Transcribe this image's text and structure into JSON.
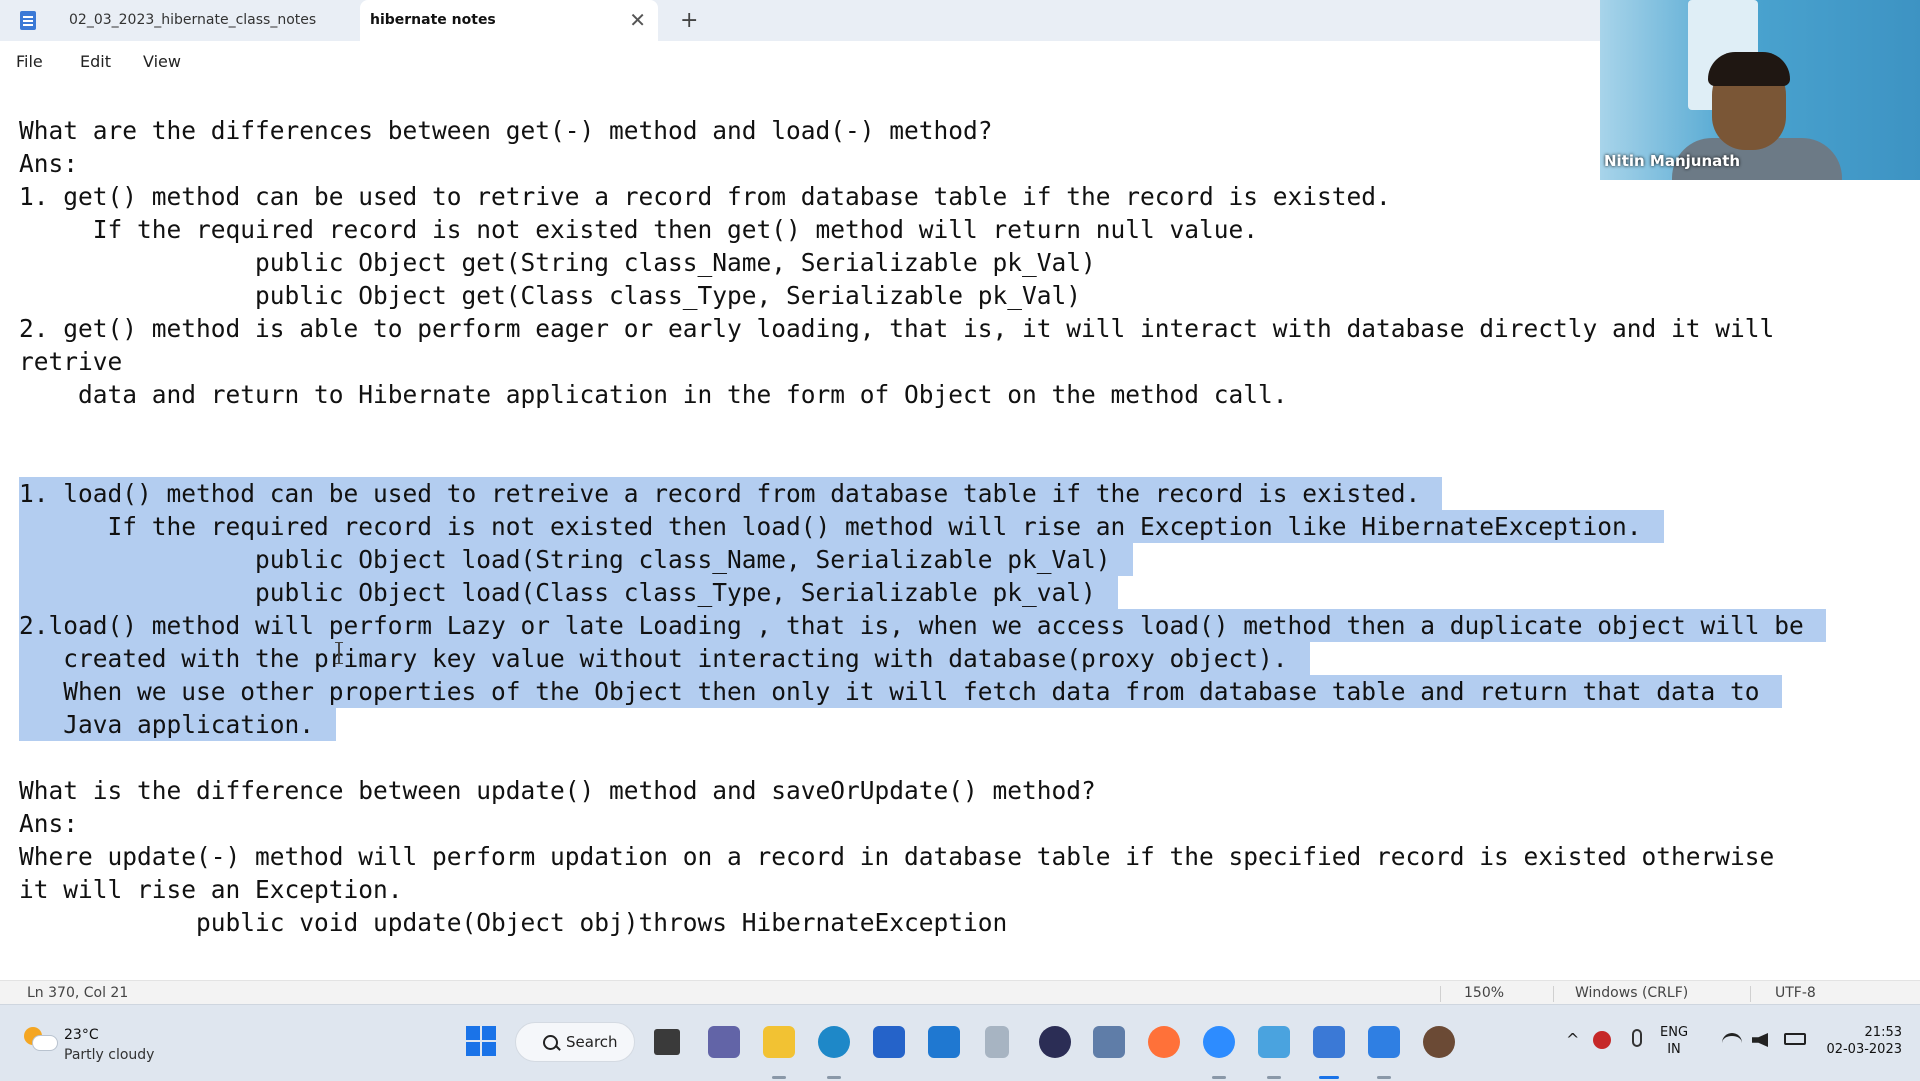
{
  "tabs": [
    {
      "label": "02_03_2023_hibernate_class_notes"
    },
    {
      "label": "hibernate notes",
      "active": true
    }
  ],
  "close_glyph": "✕",
  "add_glyph": "+",
  "menu": {
    "file": "File",
    "edit": "Edit",
    "view": "View"
  },
  "editor_lines": [
    {
      "text": "What are the differences between get(-) method and load(-) method?",
      "selected": false
    },
    {
      "text": "Ans:",
      "selected": false
    },
    {
      "text": "1. get() method can be used to retrive a record from database table if the record is existed.",
      "selected": false
    },
    {
      "text": "     If the required record is not existed then get() method will return null value.",
      "selected": false
    },
    {
      "text": "                public Object get(String class_Name, Serializable pk_Val)",
      "selected": false
    },
    {
      "text": "                public Object get(Class class_Type, Serializable pk_Val)",
      "selected": false
    },
    {
      "text": "2. get() method is able to perform eager or early loading, that is, it will interact with database directly and it will",
      "selected": false
    },
    {
      "text": "retrive",
      "selected": false
    },
    {
      "text": "    data and return to Hibernate application in the form of Object on the method call.",
      "selected": false
    },
    {
      "text": "",
      "selected": false
    },
    {
      "text": "",
      "selected": false
    },
    {
      "text": "1. load() method can be used to retreive a record from database table if the record is existed.",
      "selected": true
    },
    {
      "text": "      If the required record is not existed then load() method will rise an Exception like HibernateException.",
      "selected": true
    },
    {
      "text": "                public Object load(String class_Name, Serializable pk_Val)",
      "selected": true
    },
    {
      "text": "                public Object load(Class class_Type, Serializable pk_val)",
      "selected": true
    },
    {
      "text": "2.load() method will perform Lazy or late Loading , that is, when we access load() method then a duplicate object will be",
      "selected": true
    },
    {
      "text": "   created with the primary key value without interacting with database(proxy object).",
      "selected": true
    },
    {
      "text": "   When we use other properties of the Object then only it will fetch data from database table and return that data to",
      "selected": true
    },
    {
      "text": "   Java application.",
      "selected": true
    },
    {
      "text": "",
      "selected": false
    },
    {
      "text": "What is the difference between update() method and saveOrUpdate() method?",
      "selected": false
    },
    {
      "text": "Ans:",
      "selected": false
    },
    {
      "text": "Where update(-) method will perform updation on a record in database table if the specified record is existed otherwise",
      "selected": false
    },
    {
      "text": "it will rise an Exception.",
      "selected": false
    },
    {
      "text": "            public void update(Object obj)throws HibernateException",
      "selected": false
    }
  ],
  "status": {
    "position": "Ln 370, Col 21",
    "zoom": "150%",
    "line_ending": "Windows (CRLF)",
    "encoding": "UTF-8"
  },
  "webcam": {
    "name": "Nitin Manjunath"
  },
  "taskbar": {
    "temperature": "23°C",
    "condition": "Partly cloudy",
    "search_label": "Search",
    "lang_top": "ENG",
    "lang_bottom": "IN",
    "time": "21:53",
    "date": "02-03-2023",
    "chevron": "^"
  },
  "colors": {
    "selection": "#b3cdf0",
    "accent": "#1a73e8"
  }
}
